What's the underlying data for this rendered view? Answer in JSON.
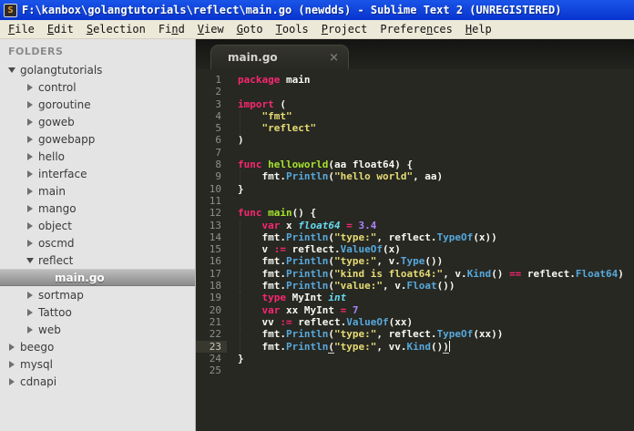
{
  "window": {
    "title": "F:\\kanbox\\golangtutorials\\reflect\\main.go (newdds) - Sublime Text 2 (UNREGISTERED)",
    "icon_letter": "S"
  },
  "menu": {
    "items": [
      {
        "pre": "",
        "key": "F",
        "post": "ile"
      },
      {
        "pre": "",
        "key": "E",
        "post": "dit"
      },
      {
        "pre": "",
        "key": "S",
        "post": "election"
      },
      {
        "pre": "Fi",
        "key": "n",
        "post": "d"
      },
      {
        "pre": "",
        "key": "V",
        "post": "iew"
      },
      {
        "pre": "",
        "key": "G",
        "post": "oto"
      },
      {
        "pre": "",
        "key": "T",
        "post": "ools"
      },
      {
        "pre": "",
        "key": "P",
        "post": "roject"
      },
      {
        "pre": "Prefere",
        "key": "n",
        "post": "ces"
      },
      {
        "pre": "",
        "key": "H",
        "post": "elp"
      }
    ]
  },
  "sidebar": {
    "header": "FOLDERS",
    "tree": [
      {
        "label": "golangtutorials",
        "depth": 0,
        "state": "expanded",
        "selected": false
      },
      {
        "label": "control",
        "depth": 1,
        "state": "collapsed",
        "selected": false
      },
      {
        "label": "goroutine",
        "depth": 1,
        "state": "collapsed",
        "selected": false
      },
      {
        "label": "goweb",
        "depth": 1,
        "state": "collapsed",
        "selected": false
      },
      {
        "label": "gowebapp",
        "depth": 1,
        "state": "collapsed",
        "selected": false
      },
      {
        "label": "hello",
        "depth": 1,
        "state": "collapsed",
        "selected": false
      },
      {
        "label": "interface",
        "depth": 1,
        "state": "collapsed",
        "selected": false
      },
      {
        "label": "main",
        "depth": 1,
        "state": "collapsed",
        "selected": false
      },
      {
        "label": "mango",
        "depth": 1,
        "state": "collapsed",
        "selected": false
      },
      {
        "label": "object",
        "depth": 1,
        "state": "collapsed",
        "selected": false
      },
      {
        "label": "oscmd",
        "depth": 1,
        "state": "collapsed",
        "selected": false
      },
      {
        "label": "reflect",
        "depth": 1,
        "state": "expanded",
        "selected": false
      },
      {
        "label": "main.go",
        "depth": 2,
        "state": "file",
        "selected": true
      },
      {
        "label": "sortmap",
        "depth": 1,
        "state": "collapsed",
        "selected": false
      },
      {
        "label": "Tattoo",
        "depth": 1,
        "state": "collapsed",
        "selected": false
      },
      {
        "label": "web",
        "depth": 1,
        "state": "collapsed",
        "selected": false
      },
      {
        "label": "beego",
        "depth": 0,
        "state": "collapsed",
        "selected": false
      },
      {
        "label": "mysql",
        "depth": 0,
        "state": "collapsed",
        "selected": false
      },
      {
        "label": "cdnapi",
        "depth": 0,
        "state": "collapsed",
        "selected": false
      }
    ]
  },
  "tabs": {
    "active": {
      "label": "main.go",
      "close_glyph": "×"
    }
  },
  "editor": {
    "caret_line": 23,
    "total_lines": 25,
    "lines": [
      [
        [
          "k",
          "package"
        ],
        [
          "w",
          " main"
        ]
      ],
      [],
      [
        [
          "k",
          "import"
        ],
        [
          "w",
          " ("
        ]
      ],
      [
        [
          "w",
          "    "
        ],
        [
          "s",
          "\"fmt\""
        ]
      ],
      [
        [
          "w",
          "    "
        ],
        [
          "s",
          "\"reflect\""
        ]
      ],
      [
        [
          "w",
          ")"
        ]
      ],
      [],
      [
        [
          "k",
          "func"
        ],
        [
          "w",
          " "
        ],
        [
          "g",
          "helloworld"
        ],
        [
          "w",
          "(aa float64) {"
        ]
      ],
      [
        [
          "w",
          "    fmt."
        ],
        [
          "f",
          "Println"
        ],
        [
          "w",
          "("
        ],
        [
          "s",
          "\"hello world\""
        ],
        [
          "w",
          ", aa)"
        ]
      ],
      [
        [
          "w",
          "}"
        ]
      ],
      [],
      [
        [
          "k",
          "func"
        ],
        [
          "w",
          " "
        ],
        [
          "g",
          "main"
        ],
        [
          "w",
          "() {"
        ]
      ],
      [
        [
          "w",
          "    "
        ],
        [
          "k",
          "var"
        ],
        [
          "w",
          " x "
        ],
        [
          "t",
          "float64"
        ],
        [
          "w",
          " "
        ],
        [
          "k",
          "="
        ],
        [
          "w",
          " "
        ],
        [
          "n",
          "3.4"
        ]
      ],
      [
        [
          "w",
          "    fmt."
        ],
        [
          "f",
          "Println"
        ],
        [
          "w",
          "("
        ],
        [
          "s",
          "\"type:\""
        ],
        [
          "w",
          ", reflect."
        ],
        [
          "f",
          "TypeOf"
        ],
        [
          "w",
          "(x))"
        ]
      ],
      [
        [
          "w",
          "    v "
        ],
        [
          "k",
          ":="
        ],
        [
          "w",
          " reflect."
        ],
        [
          "f",
          "ValueOf"
        ],
        [
          "w",
          "(x)"
        ]
      ],
      [
        [
          "w",
          "    fmt."
        ],
        [
          "f",
          "Println"
        ],
        [
          "w",
          "("
        ],
        [
          "s",
          "\"type:\""
        ],
        [
          "w",
          ", v."
        ],
        [
          "f",
          "Type"
        ],
        [
          "w",
          "())"
        ]
      ],
      [
        [
          "w",
          "    fmt."
        ],
        [
          "f",
          "Println"
        ],
        [
          "w",
          "("
        ],
        [
          "s",
          "\"kind is float64:\""
        ],
        [
          "w",
          ", v."
        ],
        [
          "f",
          "Kind"
        ],
        [
          "w",
          "() "
        ],
        [
          "k",
          "=="
        ],
        [
          "w",
          " reflect."
        ],
        [
          "f",
          "Float64"
        ],
        [
          "w",
          ")"
        ]
      ],
      [
        [
          "w",
          "    fmt."
        ],
        [
          "f",
          "Println"
        ],
        [
          "w",
          "("
        ],
        [
          "s",
          "\"value:\""
        ],
        [
          "w",
          ", v."
        ],
        [
          "f",
          "Float"
        ],
        [
          "w",
          "())"
        ]
      ],
      [
        [
          "w",
          "    "
        ],
        [
          "k",
          "type"
        ],
        [
          "w",
          " MyInt "
        ],
        [
          "t",
          "int"
        ]
      ],
      [
        [
          "w",
          "    "
        ],
        [
          "k",
          "var"
        ],
        [
          "w",
          " xx MyInt "
        ],
        [
          "k",
          "="
        ],
        [
          "w",
          " "
        ],
        [
          "n",
          "7"
        ]
      ],
      [
        [
          "w",
          "    vv "
        ],
        [
          "k",
          ":="
        ],
        [
          "w",
          " reflect."
        ],
        [
          "f",
          "ValueOf"
        ],
        [
          "w",
          "(xx)"
        ]
      ],
      [
        [
          "w",
          "    fmt."
        ],
        [
          "f",
          "Println"
        ],
        [
          "w",
          "("
        ],
        [
          "s",
          "\"type:\""
        ],
        [
          "w",
          ", reflect."
        ],
        [
          "f",
          "TypeOf"
        ],
        [
          "w",
          "(xx))"
        ]
      ],
      [
        [
          "w",
          "    fmt."
        ],
        [
          "f",
          "Println"
        ],
        [
          "u",
          "("
        ],
        [
          "s",
          "\"type:\""
        ],
        [
          "w",
          ", vv."
        ],
        [
          "f",
          "Kind"
        ],
        [
          "w",
          "()"
        ],
        [
          "u",
          ")"
        ]
      ],
      [
        [
          "w",
          "}"
        ]
      ],
      []
    ]
  },
  "colors": {
    "titlebar_blue": "#0f3fd9",
    "menubar_bg": "#ece9d8",
    "sidebar_bg": "#e4e4e4",
    "editor_bg": "#272822",
    "keyword": "#f92672",
    "function_definition": "#a6e22e",
    "library_function": "#57a8dd",
    "type_italic": "#66d9ef",
    "string": "#e6db74",
    "number": "#ae81ff",
    "default_text": "#f8f8f2",
    "line_number": "#8f908a"
  }
}
